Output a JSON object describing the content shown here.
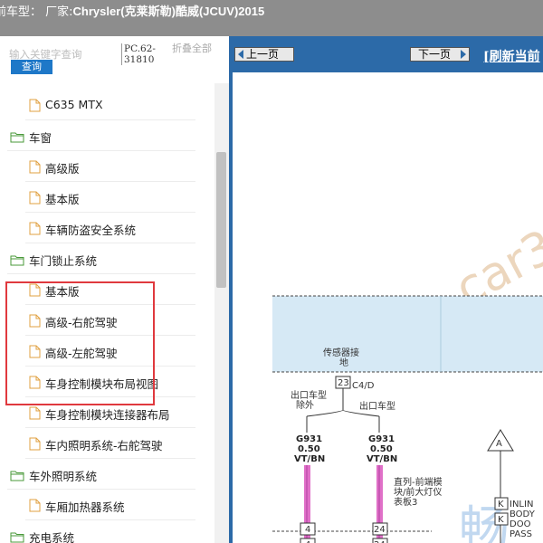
{
  "header": {
    "prefix": "前车型：",
    "maker_label": "厂家:",
    "vehicle": "Chrysler(克莱斯勒)酷威(JCUV)2015"
  },
  "search": {
    "placeholder": "输入关键字查询",
    "query_label": "查询",
    "pc_code": "PC.62-31810",
    "collapse_all": "折叠全部"
  },
  "tree": [
    {
      "type": "doc",
      "label": "C635 MTX"
    },
    {
      "type": "folder",
      "label": "车窗"
    },
    {
      "type": "doc",
      "label": "高级版"
    },
    {
      "type": "doc",
      "label": "基本版"
    },
    {
      "type": "doc",
      "label": "车辆防盗安全系统"
    },
    {
      "type": "folder",
      "label": "车门锁止系统"
    },
    {
      "type": "doc",
      "label": "基本版"
    },
    {
      "type": "doc",
      "label": "高级-右舵驾驶"
    },
    {
      "type": "doc",
      "label": "高级-左舵驾驶"
    },
    {
      "type": "doc",
      "label": "车身控制模块布局视图"
    },
    {
      "type": "doc",
      "label": "车身控制模块连接器布局"
    },
    {
      "type": "doc",
      "label": "车内照明系统-右舵驾驶"
    },
    {
      "type": "folder",
      "label": "车外照明系统"
    },
    {
      "type": "doc",
      "label": "车厢加热器系统"
    },
    {
      "type": "folder",
      "label": "充电系统"
    }
  ],
  "toolbar": {
    "prev_label": "上一页",
    "next_label": "下一页",
    "refresh_label": "[刷新当前"
  },
  "diagram": {
    "watermark": "car3",
    "watermark2": "畅",
    "sensor_ground": [
      "传感器接",
      "地"
    ],
    "connector_pin": "23",
    "connector_id": "C4/D",
    "branch_left": [
      "出口车型",
      "除外"
    ],
    "branch_right": "出口车型",
    "wire_left": {
      "id": "G931",
      "gauge": "0.50",
      "color": "VT/BN"
    },
    "wire_right": {
      "id": "G931",
      "gauge": "0.50",
      "color": "VT/BN"
    },
    "pin_left": "4",
    "pin_right": "24",
    "module_label": [
      "直列-前端模",
      "块/前大灯仪",
      "表板3"
    ],
    "right_triangle": "A",
    "right_pin": "K",
    "right_box": [
      "INLIN",
      "BODY",
      "DOO",
      "PASS"
    ]
  },
  "colors": {
    "header_bg": "#8d8d8d",
    "toolbar_bg": "#2c6aa8",
    "query_btn": "#1e78c8",
    "highlight": "#e0393e",
    "wire": "#e070c8"
  }
}
